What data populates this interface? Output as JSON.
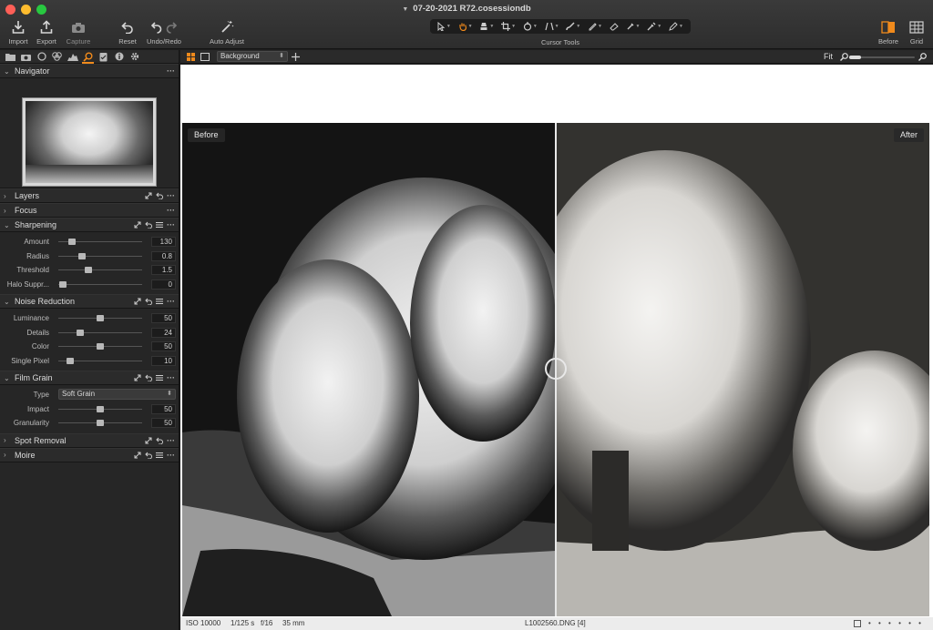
{
  "window": {
    "title": "07-20-2021 R72.cosessiondb"
  },
  "toolbar": {
    "import": "Import",
    "export": "Export",
    "capture": "Capture",
    "reset": "Reset",
    "undo_redo": "Undo/Redo",
    "auto_adjust": "Auto Adjust",
    "cursor_tools": "Cursor Tools",
    "before": "Before",
    "grid": "Grid"
  },
  "colors": {
    "accent": "#f08a1c",
    "panel": "#262626",
    "viewer_bg": "#ffffff"
  },
  "panels": {
    "navigator": {
      "title": "Navigator"
    },
    "layers": {
      "title": "Layers"
    },
    "focus": {
      "title": "Focus"
    },
    "sharpening": {
      "title": "Sharpening",
      "rows": [
        {
          "label": "Amount",
          "value": "130",
          "fraction": 0.16
        },
        {
          "label": "Radius",
          "value": "0.8",
          "fraction": 0.28
        },
        {
          "label": "Threshold",
          "value": "1.5",
          "fraction": 0.36
        },
        {
          "label": "Halo Suppr...",
          "value": "0",
          "fraction": 0.05
        }
      ]
    },
    "noise_reduction": {
      "title": "Noise Reduction",
      "rows": [
        {
          "label": "Luminance",
          "value": "50",
          "fraction": 0.5
        },
        {
          "label": "Details",
          "value": "24",
          "fraction": 0.26
        },
        {
          "label": "Color",
          "value": "50",
          "fraction": 0.5
        },
        {
          "label": "Single Pixel",
          "value": "10",
          "fraction": 0.14
        }
      ]
    },
    "film_grain": {
      "title": "Film Grain",
      "type_label": "Type",
      "type_value": "Soft Grain",
      "rows": [
        {
          "label": "Impact",
          "value": "50",
          "fraction": 0.5
        },
        {
          "label": "Granularity",
          "value": "50",
          "fraction": 0.5
        }
      ]
    },
    "spot_removal": {
      "title": "Spot Removal"
    },
    "moire": {
      "title": "Moire"
    }
  },
  "viewer": {
    "layer_select": "Background",
    "fit_label": "Fit",
    "zoom_fraction": 0.18,
    "before_badge": "Before",
    "after_badge": "After"
  },
  "status": {
    "iso": "ISO 10000",
    "shutter": "1/125 s",
    "aperture": "f/16",
    "focal": "35 mm",
    "filename": "L1002560.DNG [4]"
  }
}
